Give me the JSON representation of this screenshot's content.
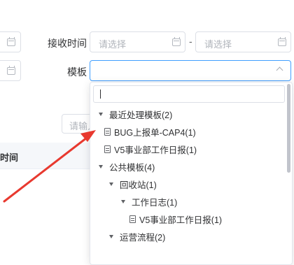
{
  "filters": {
    "receive_time_label": "接收时间",
    "template_label": "模板",
    "start_placeholder": "请选择",
    "end_placeholder": "请选择",
    "range_separator": "-",
    "search_placeholder_partial": "请输入"
  },
  "table": {
    "column_header_partial": "时间"
  },
  "dropdown": {
    "search_value": "",
    "tree": [
      {
        "label": "最近处理模板(2)",
        "type": "folder",
        "expanded": true
      },
      {
        "label": "BUG上报单-CAP4(1)",
        "type": "template"
      },
      {
        "label": "V5事业部工作日报(1)",
        "type": "template"
      },
      {
        "label": "公共模板(4)",
        "type": "folder",
        "expanded": true
      },
      {
        "label": "回收站(1)",
        "type": "folder",
        "expanded": true
      },
      {
        "label": "工作日志(1)",
        "type": "folder",
        "expanded": true
      },
      {
        "label": "V5事业部工作日报(1)",
        "type": "template"
      },
      {
        "label": "运营流程(2)",
        "type": "folder",
        "expanded": true
      }
    ]
  },
  "annotation": {
    "arrow_color": "#e8392f"
  },
  "colors": {
    "border": "#dcdfe6",
    "active_border": "#409eff",
    "placeholder": "#b0b4bb"
  }
}
